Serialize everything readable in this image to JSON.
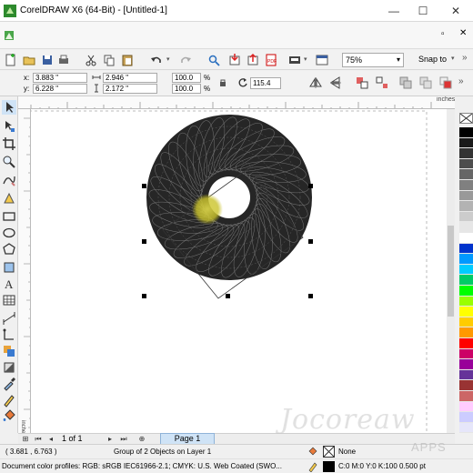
{
  "window": {
    "title": "CorelDRAW X6 (64-Bit) - [Untitled-1]",
    "minimize": "—",
    "maximize": "☐",
    "close": "✕"
  },
  "toolbar": {
    "zoom": "75%",
    "snap_to": "Snap to"
  },
  "property_bar": {
    "x_label": "x:",
    "x_value": "3.883 \"",
    "y_label": "y:",
    "y_value": "6.228 \"",
    "width_value": "2.946 \"",
    "height_value": "2.172 \"",
    "scale_w": "100.0",
    "scale_h": "100.0",
    "percent": "%",
    "rotation": "115.4"
  },
  "rulers": {
    "unit": "inches"
  },
  "page_nav": {
    "page_count": "1 of 1",
    "page_tab": "Page 1"
  },
  "status": {
    "coords": "( 3.681 , 6.763 )",
    "selection": "Group of 2 Objects on Layer 1",
    "fill": "None",
    "color_profiles": "Document color profiles: RGB: sRGB IEC61966-2.1; CMYK: U.S. Web Coated (SWO...",
    "outline": "C:0 M:0 Y:0 K:100  0.500 pt"
  },
  "watermark": {
    "text": "Jocoreaw",
    "sub": "APPS"
  },
  "palette": {
    "colors": [
      "#000000",
      "#1a1a1a",
      "#333333",
      "#4d4d4d",
      "#666666",
      "#808080",
      "#999999",
      "#b3b3b3",
      "#cccccc",
      "#e6e6e6",
      "#ffffff",
      "#0033cc",
      "#0099ff",
      "#00ccff",
      "#00cc66",
      "#00ff00",
      "#99ff00",
      "#ffff00",
      "#ffcc00",
      "#ff9900",
      "#ff0000",
      "#cc0066",
      "#990099",
      "#663399",
      "#993333",
      "#cc6666",
      "#ffccff",
      "#ccccff",
      "#e6e6fa"
    ]
  }
}
